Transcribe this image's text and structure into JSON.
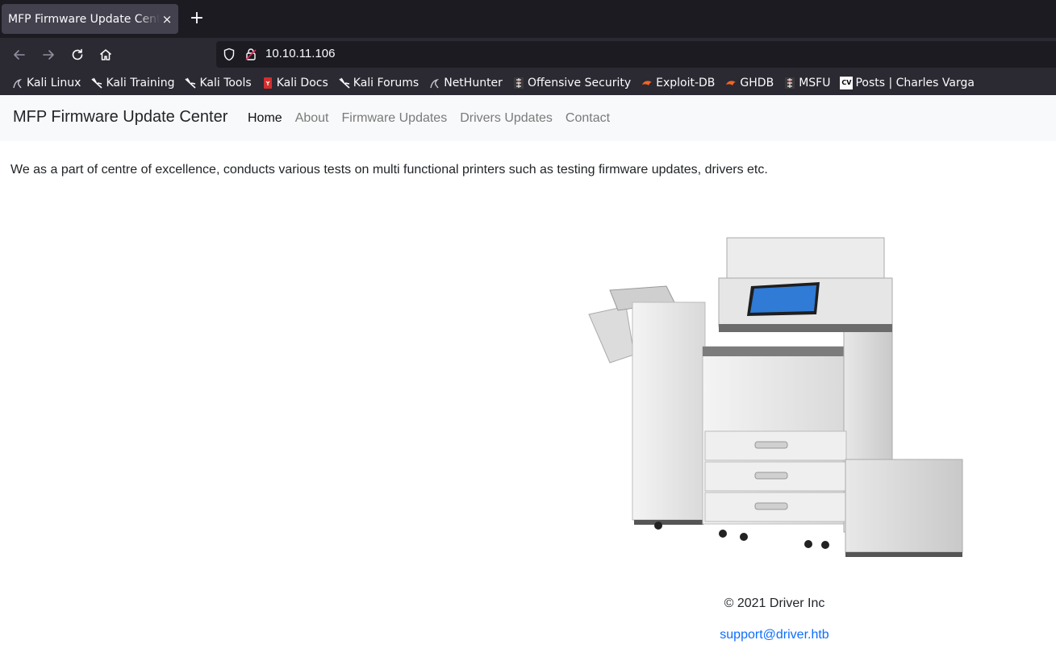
{
  "browser": {
    "tab_title": "MFP Firmware Update Center",
    "tab_close": "×",
    "new_tab": "+",
    "url": "10.10.11.106",
    "bookmarks": [
      {
        "label": "Kali Linux"
      },
      {
        "label": "Kali Training"
      },
      {
        "label": "Kali Tools"
      },
      {
        "label": "Kali Docs"
      },
      {
        "label": "Kali Forums"
      },
      {
        "label": "NetHunter"
      },
      {
        "label": "Offensive Security"
      },
      {
        "label": "Exploit-DB"
      },
      {
        "label": "GHDB"
      },
      {
        "label": "MSFU"
      },
      {
        "label": "Posts | Charles Varga"
      }
    ]
  },
  "site": {
    "brand": "MFP Firmware Update Center",
    "nav": [
      {
        "label": "Home"
      },
      {
        "label": "About"
      },
      {
        "label": "Firmware Updates"
      },
      {
        "label": "Drivers Updates"
      },
      {
        "label": "Contact"
      }
    ],
    "intro": "We as a part of centre of excellence, conducts various tests on multi functional printers such as testing firmware updates, drivers etc.",
    "copyright": "© 2021 Driver Inc",
    "support_email": "support@driver.htb"
  },
  "colors": {
    "chrome_dark": "#1c1b22",
    "chrome": "#2b2a33",
    "tab_active": "#42414d",
    "link_blue": "#0d6efd",
    "nav_bg": "#f8f9fa"
  }
}
